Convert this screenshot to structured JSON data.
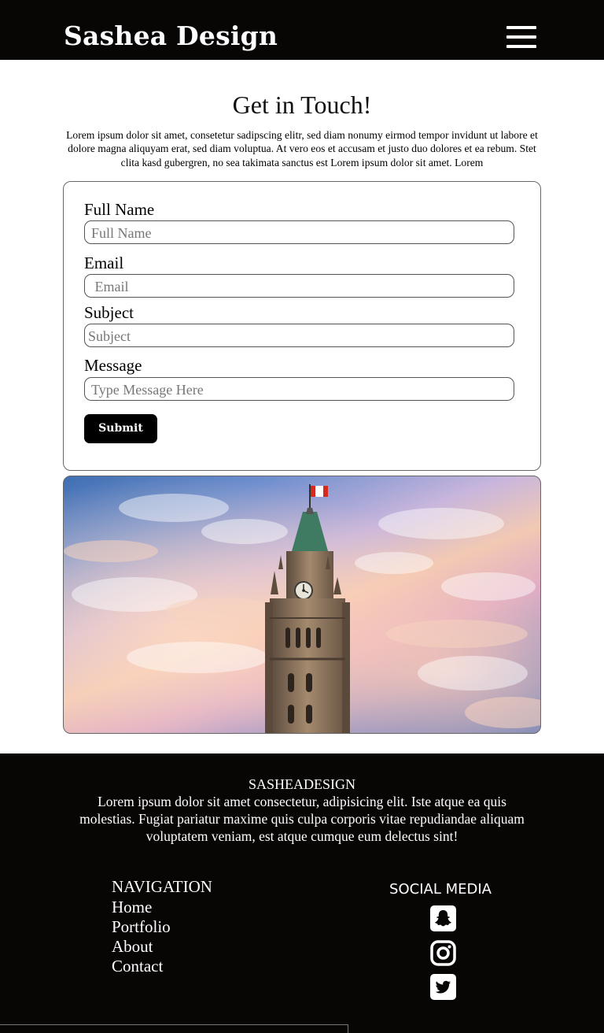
{
  "header": {
    "brand": "Sashea Design",
    "menu_icon": "hamburger-menu-icon"
  },
  "main": {
    "title": "Get in Touch!",
    "intro": "Lorem ipsum dolor sit amet, consetetur sadipscing elitr, sed diam nonumy eirmod tempor invidunt ut labore et dolore magna aliquyam erat, sed diam voluptua. At vero eos et accusam et justo duo dolores et ea rebum. Stet clita kasd gubergren, no sea takimata sanctus est Lorem ipsum dolor sit amet. Lorem"
  },
  "form": {
    "fullname_label": "Full Name",
    "fullname_placeholder": "Full Name",
    "email_label": "Email",
    "email_placeholder": " Email",
    "subject_label": "Subject",
    "subject_placeholder": "Subject",
    "message_label": "Message",
    "message_placeholder": "Type Message Here",
    "submit_label": "Submit"
  },
  "footer": {
    "brand": "SASHEADESIGN",
    "about": "Lorem ipsum dolor sit amet consectetur, adipisicing elit. Iste atque ea quis molestias. Fugiat pariatur maxime quis culpa corporis vitae repudiandae aliquam voluptatem veniam, est atque cumque eum delectus sint!",
    "nav_title": "NAVIGATION",
    "nav_links": [
      "Home",
      "Portfolio",
      "About",
      "Contact"
    ],
    "social_title": "SOCIAL MEDIA",
    "social_icons": [
      "snapchat-icon",
      "instagram-icon",
      "twitter-icon"
    ]
  },
  "colors": {
    "bar_background": "#080505",
    "text_light": "#ffffff",
    "button": "#000000"
  }
}
